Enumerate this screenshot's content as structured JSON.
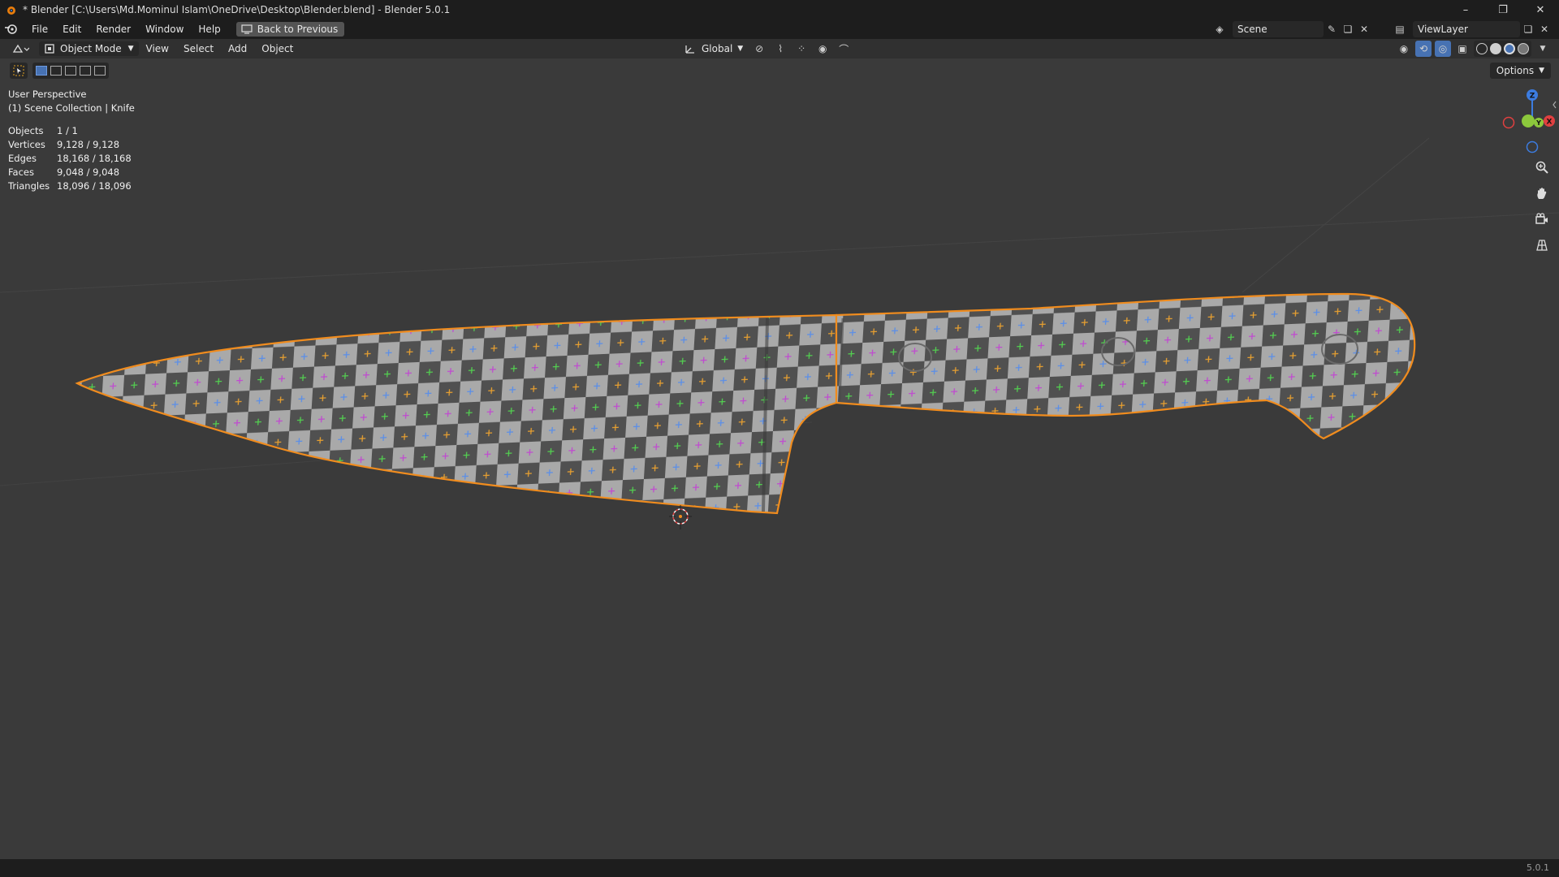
{
  "window": {
    "title": "* Blender [C:\\Users\\Md.Mominul Islam\\OneDrive\\Desktop\\Blender.blend] - Blender 5.0.1",
    "minimize": "–",
    "maximize": "❐",
    "close": "✕"
  },
  "topbar": {
    "menus": [
      "File",
      "Edit",
      "Render",
      "Window",
      "Help"
    ],
    "back_button": "Back to Previous",
    "scene": "Scene",
    "view_layer": "ViewLayer"
  },
  "header": {
    "mode": "Object Mode",
    "menus": [
      "View",
      "Select",
      "Add",
      "Object"
    ],
    "orientation": "Global",
    "options": "Options"
  },
  "overlay": {
    "perspective": "User Perspective",
    "collection": "(1) Scene Collection | Knife"
  },
  "stats": [
    {
      "label": "Objects",
      "value": "1 / 1"
    },
    {
      "label": "Vertices",
      "value": "9,128 / 9,128"
    },
    {
      "label": "Edges",
      "value": "18,168 / 18,168"
    },
    {
      "label": "Faces",
      "value": "9,048 / 9,048"
    },
    {
      "label": "Triangles",
      "value": "18,096 / 18,096"
    }
  ],
  "gizmo": {
    "x": "X",
    "y": "Y",
    "z": "Z"
  },
  "status": {
    "version": "5.0.1"
  },
  "colors": {
    "selection_outline": "#f08c1e",
    "axis_x": "#e04040",
    "axis_y": "#8cc83c",
    "axis_z": "#3c7ce0",
    "background": "#3a3a3a"
  }
}
